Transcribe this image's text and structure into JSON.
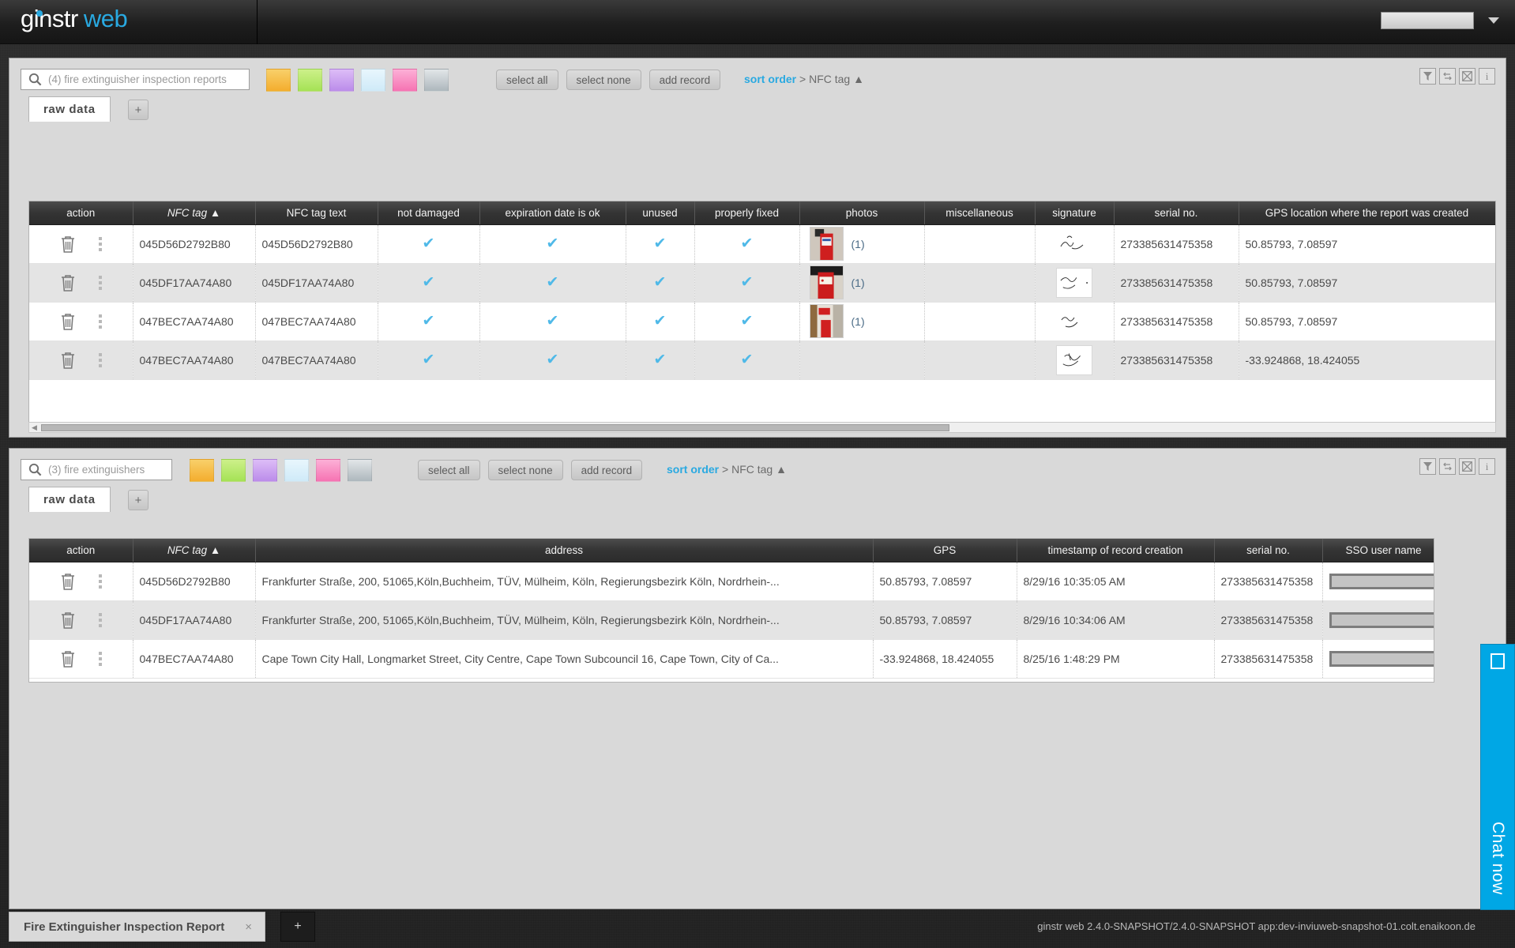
{
  "app": {
    "logo_primary": "ginstr",
    "logo_secondary": "web",
    "version_text": "ginstr web 2.4.0-SNAPSHOT/2.4.0-SNAPSHOT app:dev-inviuweb-snapshot-01.colt.enaikoon.de"
  },
  "panel_top": {
    "search_placeholder": "(4) fire extinguisher inspection reports",
    "swatches": [
      "#f6c24a",
      "#b4e86a",
      "#c9a0f0",
      "#d9eef8",
      "#f98ec4",
      "#c2c9ce"
    ],
    "buttons": {
      "select_all": "select all",
      "select_none": "select none",
      "add_record": "add record"
    },
    "sort_label": "sort order",
    "sort_value": "> NFC tag ▲",
    "tab_label": "raw  data",
    "tab_add": "+",
    "corner_icons": [
      "filter-icon",
      "swap-icon",
      "close-icon",
      "info-icon"
    ],
    "columns": [
      "action",
      "NFC tag ▲",
      "NFC tag text",
      "not damaged",
      "expiration date is ok",
      "unused",
      "properly fixed",
      "photos",
      "miscellaneous",
      "signature",
      "serial no.",
      "GPS location where the report was created"
    ],
    "rows": [
      {
        "nfc_tag": "045D56D2792B80",
        "nfc_tag_text": "045D56D2792B80",
        "not_damaged": "✔",
        "expiration_date_is_ok": "✔",
        "unused": "✔",
        "properly_fixed": "✔",
        "photos_count": "(1)",
        "has_photo": true,
        "miscellaneous": "",
        "signature_boxed": false,
        "serial_no": "273385631475358",
        "gps": "50.85793, 7.08597"
      },
      {
        "nfc_tag": "045DF17AA74A80",
        "nfc_tag_text": "045DF17AA74A80",
        "not_damaged": "✔",
        "expiration_date_is_ok": "✔",
        "unused": "✔",
        "properly_fixed": "✔",
        "photos_count": "(1)",
        "has_photo": true,
        "miscellaneous": "",
        "signature_boxed": true,
        "serial_no": "273385631475358",
        "gps": "50.85793, 7.08597"
      },
      {
        "nfc_tag": "047BEC7AA74A80",
        "nfc_tag_text": "047BEC7AA74A80",
        "not_damaged": "✔",
        "expiration_date_is_ok": "✔",
        "unused": "✔",
        "properly_fixed": "✔",
        "photos_count": "(1)",
        "has_photo": true,
        "miscellaneous": "",
        "signature_boxed": false,
        "serial_no": "273385631475358",
        "gps": "50.85793, 7.08597"
      },
      {
        "nfc_tag": "047BEC7AA74A80",
        "nfc_tag_text": "047BEC7AA74A80",
        "not_damaged": "✔",
        "expiration_date_is_ok": "✔",
        "unused": "✔",
        "properly_fixed": "✔",
        "photos_count": "",
        "has_photo": false,
        "miscellaneous": "",
        "signature_boxed": true,
        "serial_no": "273385631475358",
        "gps": "-33.924868, 18.424055"
      }
    ]
  },
  "panel_bottom": {
    "search_placeholder": "(3) fire extinguishers",
    "swatches": [
      "#f6c24a",
      "#b4e86a",
      "#c9a0f0",
      "#d9eef8",
      "#f98ec4",
      "#c2c9ce"
    ],
    "buttons": {
      "select_all": "select all",
      "select_none": "select none",
      "add_record": "add record"
    },
    "sort_label": "sort order",
    "sort_value": "> NFC tag ▲",
    "tab_label": "raw  data",
    "tab_add": "+",
    "corner_icons": [
      "filter-icon",
      "swap-icon",
      "close-icon",
      "info-icon"
    ],
    "columns": [
      "action",
      "NFC tag ▲",
      "address",
      "GPS",
      "timestamp of record creation",
      "serial no.",
      "SSO user name"
    ],
    "rows": [
      {
        "nfc_tag": "045D56D2792B80",
        "address": "Frankfurter Straße, 200, 51065,Köln,Buchheim, TÜV, Mülheim, Köln, Regierungsbezirk Köln, Nordrhein-...",
        "gps": "50.85793, 7.08597",
        "timestamp": "8/29/16 10:35:05 AM",
        "serial_no": "273385631475358",
        "sso_user_name": ""
      },
      {
        "nfc_tag": "045DF17AA74A80",
        "address": "Frankfurter Straße, 200, 51065,Köln,Buchheim, TÜV, Mülheim, Köln, Regierungsbezirk Köln, Nordrhein-...",
        "gps": "50.85793, 7.08597",
        "timestamp": "8/29/16 10:34:06 AM",
        "serial_no": "273385631475358",
        "sso_user_name": ""
      },
      {
        "nfc_tag": "047BEC7AA74A80",
        "address": "Cape Town City Hall, Longmarket Street, City Centre, Cape Town Subcouncil 16, Cape Town, City of Ca...",
        "gps": "-33.924868, 18.424055",
        "timestamp": "8/25/16 1:48:29 PM",
        "serial_no": "273385631475358",
        "sso_user_name": ""
      }
    ]
  },
  "chat": {
    "label": "Chat now",
    "icon": "chat-icon"
  },
  "bottom_bar": {
    "document_tab": "Fire Extinguisher Inspection Report",
    "document_tab_close": "×",
    "add_document": "+"
  },
  "colors": {
    "accent": "#29a9e1",
    "check": "#4fb9e8",
    "chat": "#00a7e5",
    "header": "#343434"
  }
}
